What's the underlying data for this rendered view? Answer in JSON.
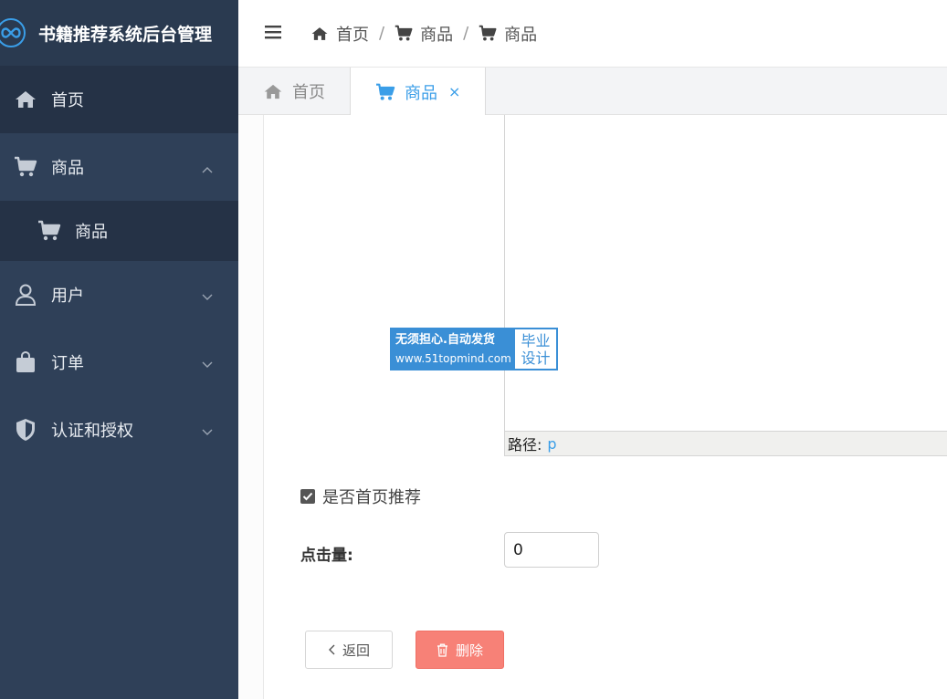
{
  "app": {
    "title": "书籍推荐系统后台管理"
  },
  "sidebar": {
    "items": [
      {
        "label": "首页"
      },
      {
        "label": "商品"
      },
      {
        "label": "商品"
      },
      {
        "label": "用户"
      },
      {
        "label": "订单"
      },
      {
        "label": "认证和授权"
      }
    ]
  },
  "breadcrumb": {
    "items": [
      "首页",
      "商品",
      "商品"
    ],
    "separator": "/"
  },
  "tabs": [
    {
      "label": "首页"
    },
    {
      "label": "商品",
      "close": "×"
    }
  ],
  "editor": {
    "path_label": "路径:",
    "path_value": "p"
  },
  "watermark": {
    "line1": "无须担心.自动发货",
    "line2": "www.51topmind.com",
    "right1": "毕业",
    "right2": "设计"
  },
  "form": {
    "checkbox_label": "是否首页推荐",
    "checkbox_checked": true,
    "clicks_label": "点击量:",
    "clicks_value": "0"
  },
  "buttons": {
    "back": "返回",
    "delete": "删除"
  },
  "colors": {
    "sidebar": "#2f4058",
    "accent": "#3a9ee8",
    "danger": "#f78177"
  }
}
